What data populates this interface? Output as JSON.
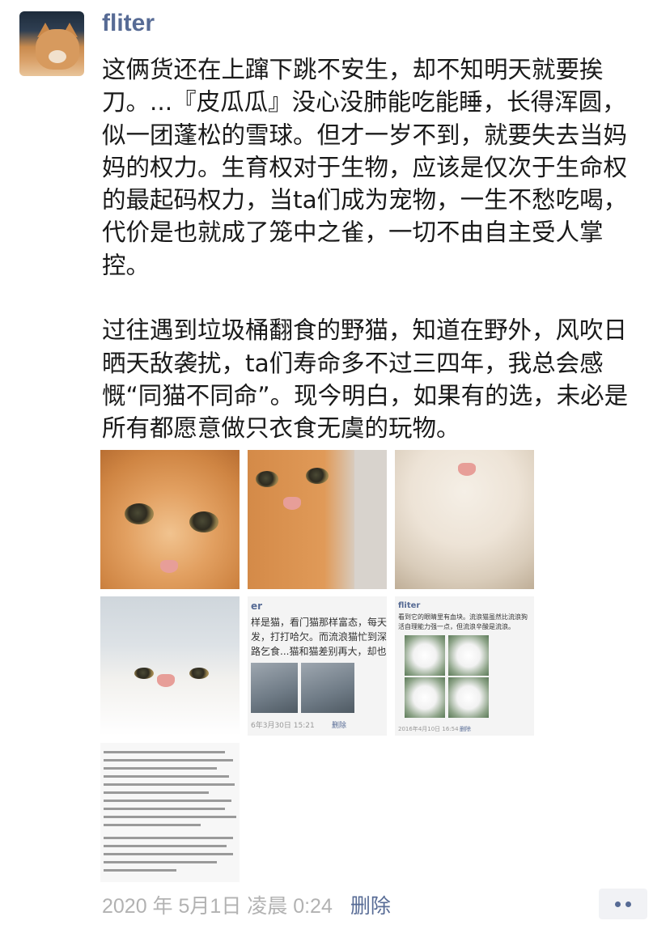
{
  "post": {
    "username": "fliter",
    "paragraphs": [
      "这俩货还在上蹿下跳不安生，却不知明天就要挨刀。...『皮瓜瓜』没心没肺能吃能睡，长得浑圆，似一团蓬松的雪球。但才一岁不到，就要失去当妈妈的权力。生育权对于生物，应该是仅次于生命权的最起码权力，当ta们成为宠物，一生不愁吃喝，代价是也就成了笼中之雀，一切不由自主受人掌控。",
      "过往遇到垃圾桶翻食的野猫，知道在野外，风吹日晒天敌袭扰，ta们寿命多不过三四年，我总会感慨“同猫不同命”。现今明白，如果有的选，未必是所有都愿意做只衣食无虞的玩物。"
    ]
  },
  "images": [
    {
      "subject": "orange-cat-closeup"
    },
    {
      "subject": "orange-cat-lying"
    },
    {
      "subject": "white-cat-chin"
    },
    {
      "subject": "white-cat-looking-up"
    },
    {
      "subject": "screenshot-post",
      "username_fragment": "er",
      "lines": [
        "样是猫，看门猫那样富态，每天无事",
        "发，打打哈欠。而流浪猫忙到深夜还",
        "路乞食...猫和猫差别再大，却也不及"
      ],
      "timestamp": "6年3月30日 15:21",
      "delete": "删除"
    },
    {
      "subject": "screenshot-post-cats",
      "username": "fliter",
      "lines": [
        "看到它的眼睛里有血块。流浪猫虽然比流浪狗",
        "活自理能力强一点，但流浪辛酸是流浪。"
      ],
      "timestamp": "2016年4月10日 16:54",
      "delete": "删除"
    },
    {
      "subject": "text-document-screenshot"
    }
  ],
  "footer": {
    "timestamp": "2020 年 5月1日 凌晨 0:24",
    "delete_label": "删除"
  },
  "icons": {
    "more": "more-dots-icon"
  },
  "colors": {
    "link": "#576b95",
    "timestamp": "#b2b2b2",
    "text": "#1a1a1a"
  }
}
